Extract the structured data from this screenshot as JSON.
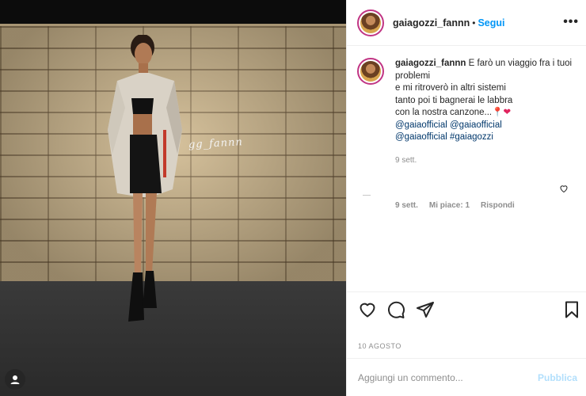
{
  "post": {
    "username": "gaiagozzi_fannn",
    "separator": "•",
    "follow_label": "Segui",
    "more_icon": "more-horizontal-icon",
    "signature_text": "gg_fannn"
  },
  "caption": {
    "username": "gaiagozzi_fannn",
    "lines": [
      "E farò un viaggio fra i tuoi problemi",
      "e mi ritroverò in altri sistemi",
      "tanto poi ti bagnerai le labbra",
      "con la nostra canzone...",
      "@gaiaofficial @gaiaofficial",
      "@gaiaofficial #gaiagozzi"
    ],
    "emoji_pin": "📍",
    "emoji_heart": "❤",
    "time": "9 sett."
  },
  "reply": {
    "time": "9 sett.",
    "likes": "Mi piace: 1",
    "reply_label": "Rispondi"
  },
  "actions": {
    "like_icon": "heart-icon",
    "comment_icon": "comment-icon",
    "share_icon": "send-icon",
    "save_icon": "bookmark-icon"
  },
  "date_label": "10 AGOSTO",
  "comment_box": {
    "placeholder": "Aggiungi un commento...",
    "publish_label": "Pubblica"
  },
  "colors": {
    "accent": "#0095f6",
    "link": "#00376b",
    "muted": "#8e8e8e",
    "publish_disabled": "#b2dffc"
  }
}
